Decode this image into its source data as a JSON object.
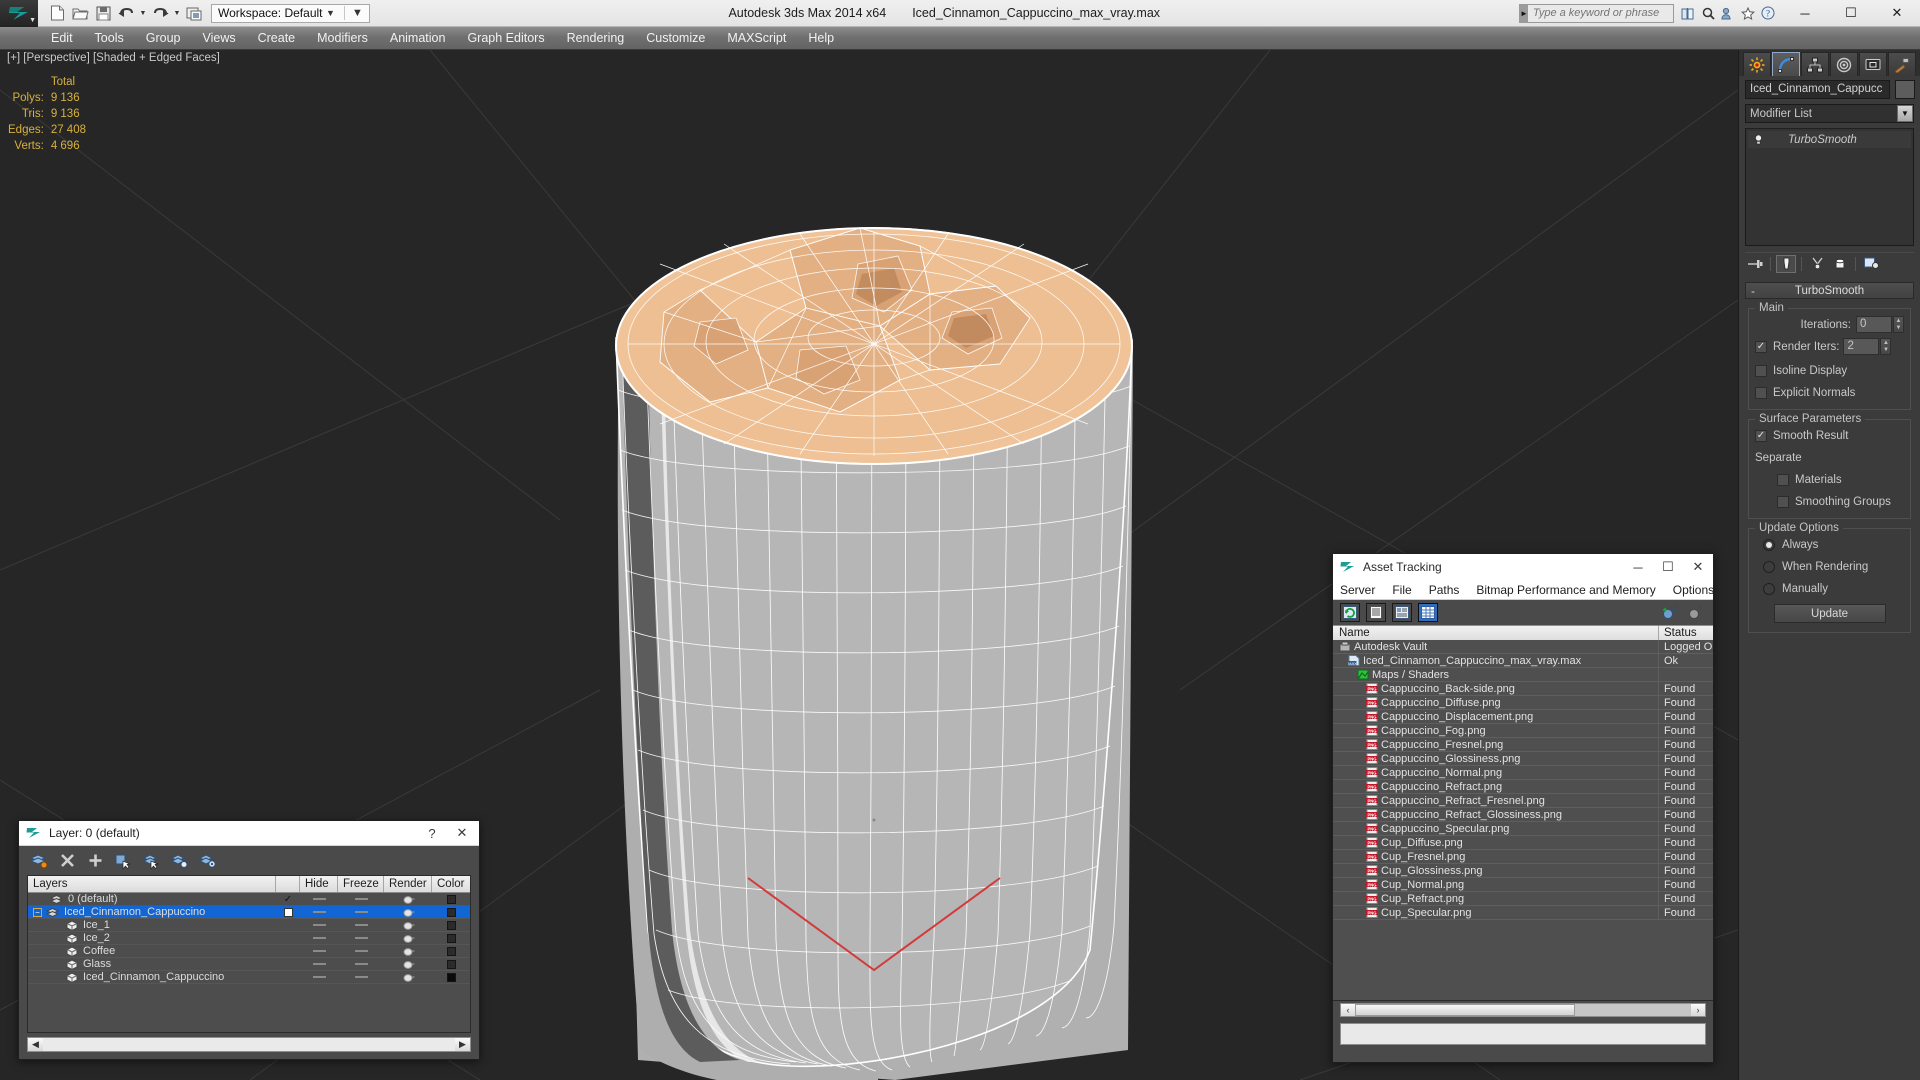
{
  "titlebar": {
    "workspace_label": "Workspace: Default",
    "app_title": "Autodesk 3ds Max  2014 x64",
    "file_title": "Iced_Cinnamon_Cappuccino_max_vray.max",
    "search_placeholder": "Type a keyword or phrase",
    "quick_access": [
      "new-icon",
      "open-icon",
      "save-icon",
      "undo-icon",
      "undo-dropdown",
      "redo-icon",
      "redo-dropdown",
      "project-folder-icon"
    ],
    "right_icons": [
      "help-book-icon",
      "search-icon",
      "community-icon",
      "favorite-icon",
      "info-icon"
    ],
    "window_buttons": {
      "minimize": "─",
      "maximize": "☐",
      "close": "✕"
    }
  },
  "menubar": {
    "items": [
      "Edit",
      "Tools",
      "Group",
      "Views",
      "Create",
      "Modifiers",
      "Animation",
      "Graph Editors",
      "Rendering",
      "Customize",
      "MAXScript",
      "Help"
    ]
  },
  "viewport": {
    "label": "[+] [Perspective] [Shaded + Edged Faces]",
    "stats_header": "Total",
    "stats": [
      {
        "key": "Polys:",
        "value": "9 136"
      },
      {
        "key": "Tris:",
        "value": "9 136"
      },
      {
        "key": "Edges:",
        "value": "27 408"
      },
      {
        "key": "Verts:",
        "value": "4 696"
      }
    ],
    "stats_color": "#d8b13c",
    "background": "#262626"
  },
  "command_panel": {
    "tabs": [
      {
        "name": "create-tab",
        "icon": "star-icon",
        "active": false
      },
      {
        "name": "modify-tab",
        "icon": "curve-icon",
        "active": true
      },
      {
        "name": "hierarchy-tab",
        "icon": "hierarchy-icon",
        "active": false
      },
      {
        "name": "motion-tab",
        "icon": "motion-icon",
        "active": false
      },
      {
        "name": "display-tab",
        "icon": "display-icon",
        "active": false
      },
      {
        "name": "utilities-tab",
        "icon": "hammer-icon",
        "active": false
      }
    ],
    "object_name": "Iced_Cinnamon_Cappucc",
    "modifier_list_label": "Modifier List",
    "stack": [
      {
        "label": "TurboSmooth"
      }
    ],
    "rollout": {
      "title": "TurboSmooth",
      "collapse_glyph": "-",
      "groups": [
        {
          "label": "Main",
          "rows": [
            {
              "type": "spinner",
              "label": "Iterations:",
              "value": "0"
            },
            {
              "type": "checkspinner",
              "label": "Render Iters:",
              "value": "2",
              "checked": true
            },
            {
              "type": "checkbox",
              "label": "Isoline Display",
              "checked": false
            },
            {
              "type": "checkbox",
              "label": "Explicit Normals",
              "checked": false
            }
          ]
        },
        {
          "label": "Surface Parameters",
          "rows": [
            {
              "type": "checkbox",
              "label": "Smooth Result",
              "checked": true
            },
            {
              "type": "text",
              "label": "Separate"
            },
            {
              "type": "checkbox-indent",
              "label": "Materials",
              "checked": false
            },
            {
              "type": "checkbox-indent",
              "label": "Smoothing Groups",
              "checked": false
            }
          ]
        },
        {
          "label": "Update Options",
          "rows": [
            {
              "type": "radio",
              "label": "Always",
              "checked": true
            },
            {
              "type": "radio",
              "label": "When Rendering",
              "checked": false
            },
            {
              "type": "radio",
              "label": "Manually",
              "checked": false
            },
            {
              "type": "button",
              "label": "Update"
            }
          ]
        }
      ]
    }
  },
  "layer_dialog": {
    "title": "Layer: 0 (default)",
    "help_glyph": "?",
    "close_glyph": "✕",
    "toolbar_icons": [
      "new-layer-icon",
      "delete-layer-icon",
      "add-layer-icon",
      "select-objects-icon",
      "select-highlighted-icon",
      "highlight-selected-icon",
      "layer-properties-icon"
    ],
    "columns": [
      "Layers",
      "",
      "Hide",
      "Freeze",
      "Render",
      "Color"
    ],
    "rows": [
      {
        "name": "0 (default)",
        "indent": 0,
        "icon": "layer-icon",
        "selected": false,
        "current": true,
        "hide": "dash",
        "freeze": "dash",
        "render": "teapot",
        "color": "#2b2b2b"
      },
      {
        "name": "Iced_Cinnamon_Cappuccino",
        "indent": 0,
        "icon": "layer-icon",
        "selected": true,
        "current": false,
        "expander": "-",
        "hide": "dash",
        "freeze": "dash",
        "render": "teapot",
        "color": "#2b2b2b"
      },
      {
        "name": "Ice_1",
        "indent": 1,
        "icon": "object-icon",
        "selected": false,
        "hide": "dash",
        "freeze": "dash",
        "render": "teapot",
        "color": "#2b2b2b"
      },
      {
        "name": "Ice_2",
        "indent": 1,
        "icon": "object-icon",
        "selected": false,
        "hide": "dash",
        "freeze": "dash",
        "render": "teapot",
        "color": "#2b2b2b"
      },
      {
        "name": "Coffee",
        "indent": 1,
        "icon": "object-icon",
        "selected": false,
        "hide": "dash",
        "freeze": "dash",
        "render": "teapot",
        "color": "#2b2b2b"
      },
      {
        "name": "Glass",
        "indent": 1,
        "icon": "object-icon",
        "selected": false,
        "hide": "dash",
        "freeze": "dash",
        "render": "teapot",
        "color": "#2b2b2b"
      },
      {
        "name": "Iced_Cinnamon_Cappuccino",
        "indent": 1,
        "icon": "object-icon",
        "selected": false,
        "hide": "dash",
        "freeze": "dash",
        "render": "teapot",
        "color": "#0a0a0a"
      }
    ],
    "selection_color": "#1266d4"
  },
  "asset_tracking": {
    "title": "Asset Tracking",
    "window_buttons": {
      "minimize": "─",
      "maximize": "☐",
      "close": "✕"
    },
    "menu": [
      "Server",
      "File",
      "Paths",
      "Bitmap Performance and Memory",
      "Options"
    ],
    "toolbar_icons": [
      "refresh-icon",
      "list-view-icon",
      "detail-view-icon",
      "grid-view-icon"
    ],
    "toolbar_right_icons": [
      "add-help-icon",
      "query-help-icon"
    ],
    "columns": {
      "name": "Name",
      "status": "Status"
    },
    "rows": [
      {
        "name": "Autodesk Vault",
        "status": "Logged Ou",
        "indent": 0,
        "icon": "vault-icon"
      },
      {
        "name": "Iced_Cinnamon_Cappuccino_max_vray.max",
        "status": "Ok",
        "indent": 1,
        "icon": "max-icon"
      },
      {
        "name": "Maps / Shaders",
        "status": "",
        "indent": 2,
        "icon": "maps-icon"
      },
      {
        "name": "Cappuccino_Back-side.png",
        "status": "Found",
        "indent": 3,
        "icon": "png-icon"
      },
      {
        "name": "Cappuccino_Diffuse.png",
        "status": "Found",
        "indent": 3,
        "icon": "png-icon"
      },
      {
        "name": "Cappuccino_Displacement.png",
        "status": "Found",
        "indent": 3,
        "icon": "png-icon"
      },
      {
        "name": "Cappuccino_Fog.png",
        "status": "Found",
        "indent": 3,
        "icon": "png-icon"
      },
      {
        "name": "Cappuccino_Fresnel.png",
        "status": "Found",
        "indent": 3,
        "icon": "png-icon"
      },
      {
        "name": "Cappuccino_Glossiness.png",
        "status": "Found",
        "indent": 3,
        "icon": "png-icon"
      },
      {
        "name": "Cappuccino_Normal.png",
        "status": "Found",
        "indent": 3,
        "icon": "png-icon"
      },
      {
        "name": "Cappuccino_Refract.png",
        "status": "Found",
        "indent": 3,
        "icon": "png-icon"
      },
      {
        "name": "Cappuccino_Refract_Fresnel.png",
        "status": "Found",
        "indent": 3,
        "icon": "png-icon"
      },
      {
        "name": "Cappuccino_Refract_Glossiness.png",
        "status": "Found",
        "indent": 3,
        "icon": "png-icon"
      },
      {
        "name": "Cappuccino_Specular.png",
        "status": "Found",
        "indent": 3,
        "icon": "png-icon"
      },
      {
        "name": "Cup_Diffuse.png",
        "status": "Found",
        "indent": 3,
        "icon": "png-icon"
      },
      {
        "name": "Cup_Fresnel.png",
        "status": "Found",
        "indent": 3,
        "icon": "png-icon"
      },
      {
        "name": "Cup_Glossiness.png",
        "status": "Found",
        "indent": 3,
        "icon": "png-icon"
      },
      {
        "name": "Cup_Normal.png",
        "status": "Found",
        "indent": 3,
        "icon": "png-icon"
      },
      {
        "name": "Cup_Refract.png",
        "status": "Found",
        "indent": 3,
        "icon": "png-icon"
      },
      {
        "name": "Cup_Specular.png",
        "status": "Found",
        "indent": 3,
        "icon": "png-icon"
      }
    ],
    "scroll_arrows": {
      "left": "‹",
      "right": "›"
    }
  },
  "model": {
    "description": "Iced cinnamon cappuccino cup wireframe model",
    "foam_color": "#edbf92",
    "cup_color": "#b4b4b4",
    "wire_color": "#ffffff"
  }
}
